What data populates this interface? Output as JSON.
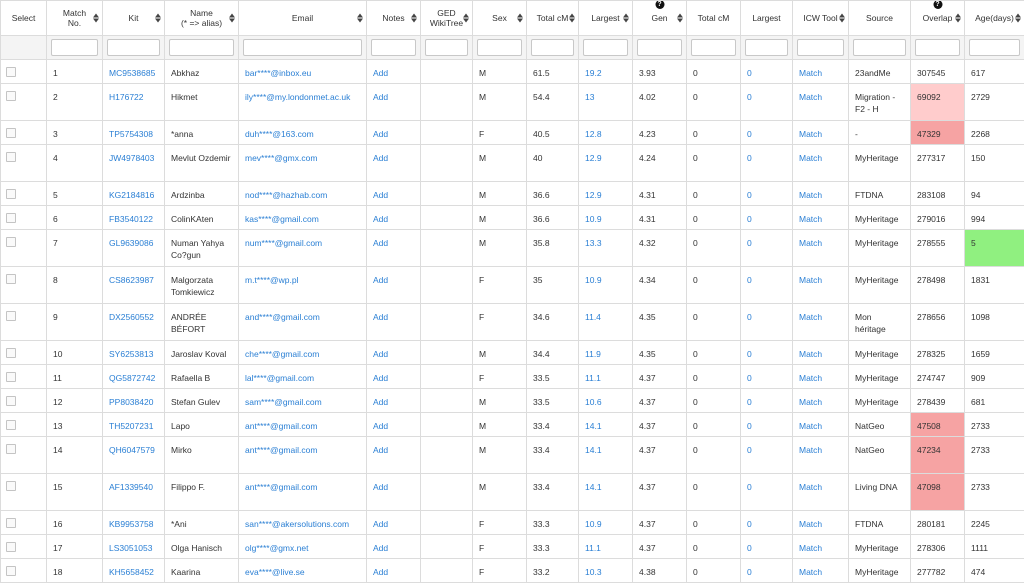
{
  "headers": [
    {
      "l1": "Select",
      "l2": "",
      "sort": false,
      "help": false
    },
    {
      "l1": "Match",
      "l2": "No.",
      "sort": true,
      "help": false
    },
    {
      "l1": "Kit",
      "l2": "",
      "sort": true,
      "help": false
    },
    {
      "l1": "Name",
      "l2": "(* => alias)",
      "sort": true,
      "help": false
    },
    {
      "l1": "Email",
      "l2": "",
      "sort": true,
      "help": false
    },
    {
      "l1": "Notes",
      "l2": "",
      "sort": true,
      "help": false
    },
    {
      "l1": "GED",
      "l2": "WikiTree",
      "sort": true,
      "help": false
    },
    {
      "l1": "Sex",
      "l2": "",
      "sort": true,
      "help": false
    },
    {
      "l1": "Total cM",
      "l2": "",
      "sort": true,
      "help": false
    },
    {
      "l1": "Largest",
      "l2": "",
      "sort": true,
      "help": false
    },
    {
      "l1": "Gen",
      "l2": "",
      "sort": true,
      "help": true
    },
    {
      "l1": "Total cM",
      "l2": "",
      "sort": false,
      "help": false
    },
    {
      "l1": "Largest",
      "l2": "",
      "sort": false,
      "help": false
    },
    {
      "l1": "ICW Tool",
      "l2": "",
      "sort": true,
      "help": false
    },
    {
      "l1": "Source",
      "l2": "",
      "sort": false,
      "help": false
    },
    {
      "l1": "Overlap",
      "l2": "",
      "sort": true,
      "help": true
    },
    {
      "l1": "Age(days)",
      "l2": "",
      "sort": true,
      "help": false
    }
  ],
  "colors": {
    "link": "#2a7fd4",
    "overlap_light": "#ffcccc",
    "overlap_red": "#f6a3a3",
    "overlap_green": "#90f080"
  },
  "rows": [
    {
      "no": "1",
      "kit": "MC9538685",
      "name": "Abkhaz",
      "email": "bar****@inbox.eu",
      "notes": "Add",
      "sex": "M",
      "total": "61.5",
      "largest": "19.2",
      "gen": "3.93",
      "t2": "0",
      "l2": "0",
      "icw": "Match",
      "source": "23andMe",
      "overlap": "307545",
      "overlap_hl": "",
      "age": "617",
      "tall": false
    },
    {
      "no": "2",
      "kit": "H176722",
      "name": "Hikmet",
      "email": "ily****@my.londonmet.ac.uk",
      "notes": "Add",
      "sex": "M",
      "total": "54.4",
      "largest": "13",
      "gen": "4.02",
      "t2": "0",
      "l2": "0",
      "icw": "Match",
      "source": "Migration - F2 - H",
      "overlap": "69092",
      "overlap_hl": "hl1",
      "age": "2729",
      "tall": true
    },
    {
      "no": "3",
      "kit": "TP5754308",
      "name": "*anna",
      "email": "duh****@163.com",
      "notes": "Add",
      "sex": "F",
      "total": "40.5",
      "largest": "12.8",
      "gen": "4.23",
      "t2": "0",
      "l2": "0",
      "icw": "Match",
      "source": "-",
      "overlap": "47329",
      "overlap_hl": "hl2",
      "age": "2268",
      "tall": false
    },
    {
      "no": "4",
      "kit": "JW4978403",
      "name": "Mevlut Ozdemir",
      "email": "mev****@gmx.com",
      "notes": "Add",
      "sex": "M",
      "total": "40",
      "largest": "12.9",
      "gen": "4.24",
      "t2": "0",
      "l2": "0",
      "icw": "Match",
      "source": "MyHeritage",
      "overlap": "277317",
      "overlap_hl": "",
      "age": "150",
      "tall": true
    },
    {
      "no": "5",
      "kit": "KG2184816",
      "name": "Ardzinba",
      "email": "nod****@hazhab.com",
      "notes": "Add",
      "sex": "M",
      "total": "36.6",
      "largest": "12.9",
      "gen": "4.31",
      "t2": "0",
      "l2": "0",
      "icw": "Match",
      "source": "FTDNA",
      "overlap": "283108",
      "overlap_hl": "",
      "age": "94",
      "tall": false
    },
    {
      "no": "6",
      "kit": "FB3540122",
      "name": "ColinKAten",
      "email": "kas****@gmail.com",
      "notes": "Add",
      "sex": "M",
      "total": "36.6",
      "largest": "10.9",
      "gen": "4.31",
      "t2": "0",
      "l2": "0",
      "icw": "Match",
      "source": "MyHeritage",
      "overlap": "279016",
      "overlap_hl": "",
      "age": "994",
      "tall": false
    },
    {
      "no": "7",
      "kit": "GL9639086",
      "name": "Numan Yahya Co?gun",
      "email": "num****@gmail.com",
      "notes": "Add",
      "sex": "M",
      "total": "35.8",
      "largest": "13.3",
      "gen": "4.32",
      "t2": "0",
      "l2": "0",
      "icw": "Match",
      "source": "MyHeritage",
      "overlap": "278555",
      "overlap_hl": "",
      "age": "5",
      "age_hl": "hl3",
      "tall": true
    },
    {
      "no": "8",
      "kit": "CS8623987",
      "name": "Malgorzata Tomkiewicz",
      "email": "m.t****@wp.pl",
      "notes": "Add",
      "sex": "F",
      "total": "35",
      "largest": "10.9",
      "gen": "4.34",
      "t2": "0",
      "l2": "0",
      "icw": "Match",
      "source": "MyHeritage",
      "overlap": "278498",
      "overlap_hl": "",
      "age": "1831",
      "tall": true
    },
    {
      "no": "9",
      "kit": "DX2560552",
      "name": "ANDRÉE BÉFORT",
      "email": "and****@gmail.com",
      "notes": "Add",
      "sex": "F",
      "total": "34.6",
      "largest": "11.4",
      "gen": "4.35",
      "t2": "0",
      "l2": "0",
      "icw": "Match",
      "source": "Mon héritage",
      "overlap": "278656",
      "overlap_hl": "",
      "age": "1098",
      "tall": true
    },
    {
      "no": "10",
      "kit": "SY6253813",
      "name": "Jaroslav Koval",
      "email": "che****@gmail.com",
      "notes": "Add",
      "sex": "M",
      "total": "34.4",
      "largest": "11.9",
      "gen": "4.35",
      "t2": "0",
      "l2": "0",
      "icw": "Match",
      "source": "MyHeritage",
      "overlap": "278325",
      "overlap_hl": "",
      "age": "1659",
      "tall": false
    },
    {
      "no": "11",
      "kit": "QG5872742",
      "name": "Rafaella B",
      "email": "lal****@gmail.com",
      "notes": "Add",
      "sex": "F",
      "total": "33.5",
      "largest": "11.1",
      "gen": "4.37",
      "t2": "0",
      "l2": "0",
      "icw": "Match",
      "source": "MyHeritage",
      "overlap": "274747",
      "overlap_hl": "",
      "age": "909",
      "tall": false
    },
    {
      "no": "12",
      "kit": "PP8038420",
      "name": "Stefan Gulev",
      "email": "sam****@gmail.com",
      "notes": "Add",
      "sex": "M",
      "total": "33.5",
      "largest": "10.6",
      "gen": "4.37",
      "t2": "0",
      "l2": "0",
      "icw": "Match",
      "source": "MyHeritage",
      "overlap": "278439",
      "overlap_hl": "",
      "age": "681",
      "tall": false
    },
    {
      "no": "13",
      "kit": "TH5207231",
      "name": "Lapo",
      "email": "ant****@gmail.com",
      "notes": "Add",
      "sex": "M",
      "total": "33.4",
      "largest": "14.1",
      "gen": "4.37",
      "t2": "0",
      "l2": "0",
      "icw": "Match",
      "source": "NatGeo",
      "overlap": "47508",
      "overlap_hl": "hl2",
      "age": "2733",
      "tall": false
    },
    {
      "no": "14",
      "kit": "QH6047579",
      "name": "Mirko",
      "email": "ant****@gmail.com",
      "notes": "Add",
      "sex": "M",
      "total": "33.4",
      "largest": "14.1",
      "gen": "4.37",
      "t2": "0",
      "l2": "0",
      "icw": "Match",
      "source": "NatGeo",
      "overlap": "47234",
      "overlap_hl": "hl2",
      "age": "2733",
      "tall": true
    },
    {
      "no": "15",
      "kit": "AF1339540",
      "name": "Filippo F.",
      "email": "ant****@gmail.com",
      "notes": "Add",
      "sex": "M",
      "total": "33.4",
      "largest": "14.1",
      "gen": "4.37",
      "t2": "0",
      "l2": "0",
      "icw": "Match",
      "source": "Living DNA",
      "overlap": "47098",
      "overlap_hl": "hl2",
      "age": "2733",
      "tall": true
    },
    {
      "no": "16",
      "kit": "KB9953758",
      "name": "*Ani",
      "email": "san****@akersolutions.com",
      "notes": "Add",
      "sex": "F",
      "total": "33.3",
      "largest": "10.9",
      "gen": "4.37",
      "t2": "0",
      "l2": "0",
      "icw": "Match",
      "source": "FTDNA",
      "overlap": "280181",
      "overlap_hl": "",
      "age": "2245",
      "tall": false
    },
    {
      "no": "17",
      "kit": "LS3051053",
      "name": "Olga Hanisch",
      "email": "olg****@gmx.net",
      "notes": "Add",
      "sex": "F",
      "total": "33.3",
      "largest": "11.1",
      "gen": "4.37",
      "t2": "0",
      "l2": "0",
      "icw": "Match",
      "source": "MyHeritage",
      "overlap": "278306",
      "overlap_hl": "",
      "age": "1111",
      "tall": false
    },
    {
      "no": "18",
      "kit": "KH5658452",
      "name": "Kaarina",
      "email": "eva****@live.se",
      "notes": "Add",
      "sex": "F",
      "total": "33.2",
      "largest": "10.3",
      "gen": "4.38",
      "t2": "0",
      "l2": "0",
      "icw": "Match",
      "source": "MyHeritage",
      "overlap": "277782",
      "overlap_hl": "",
      "age": "474",
      "tall": false
    }
  ]
}
